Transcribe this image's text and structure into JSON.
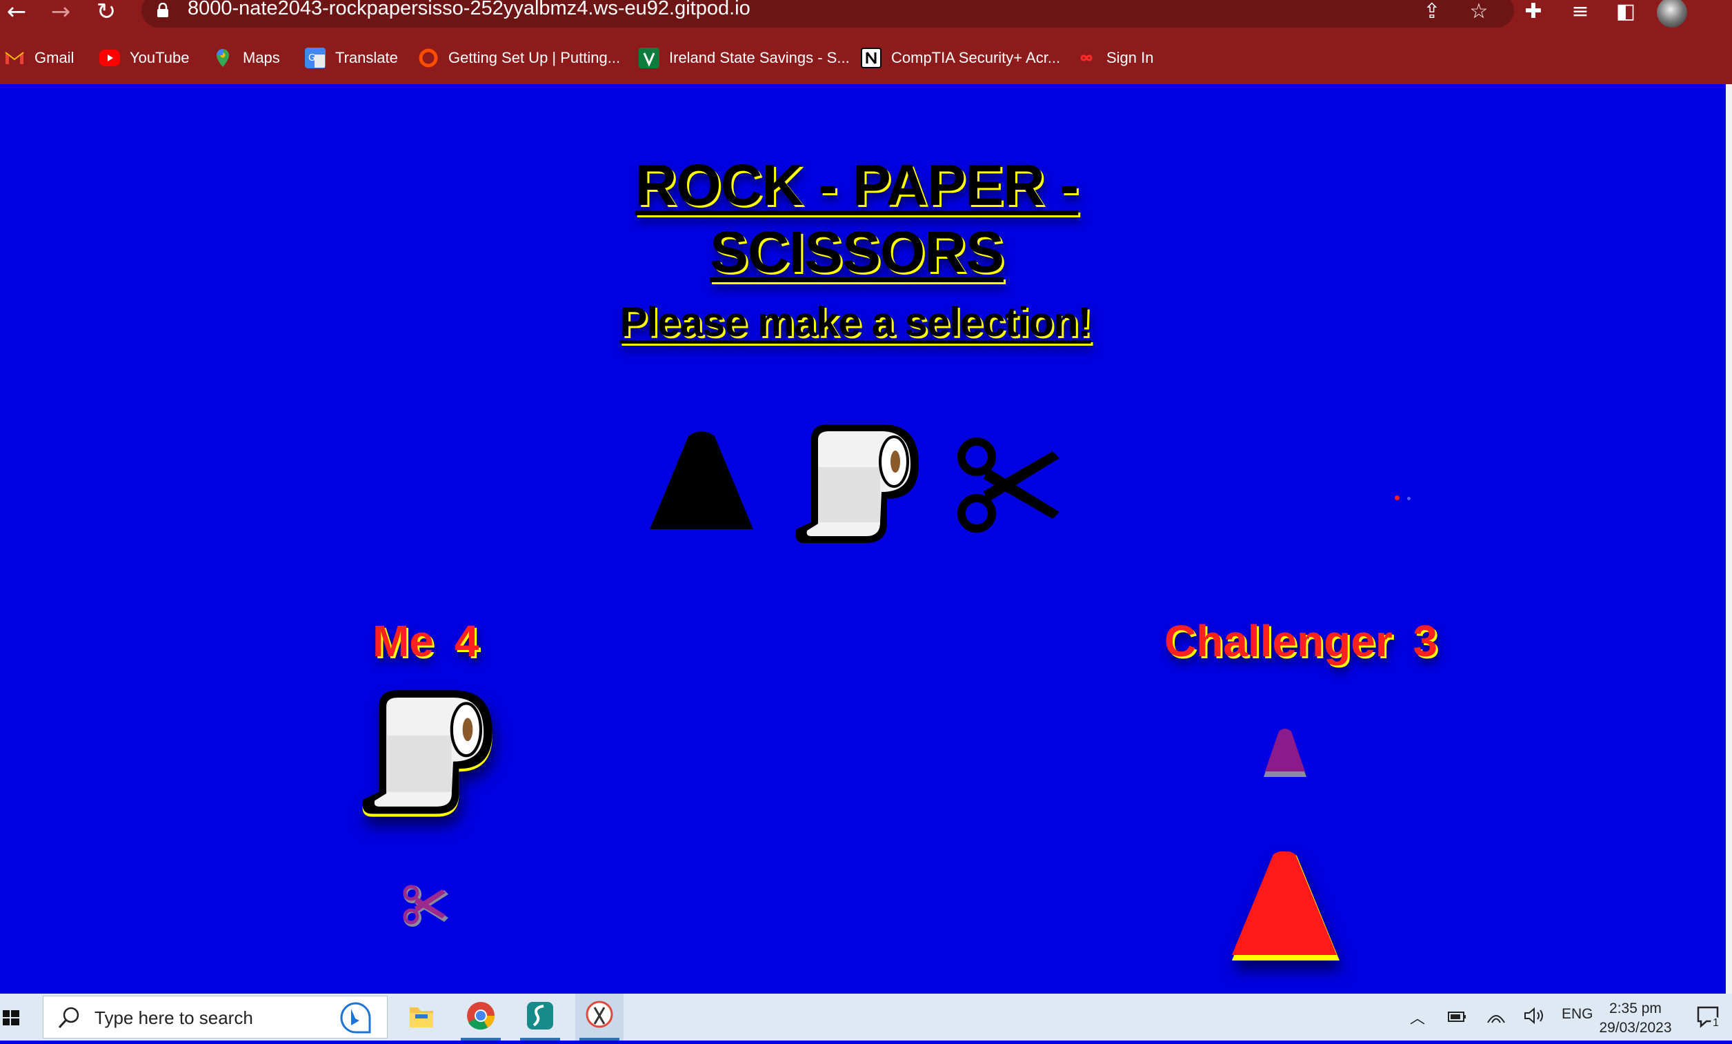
{
  "browser": {
    "url": "8000-nate2043-rockpapersisso-252yyalbmz4.ws-eu92.gitpod.io",
    "bookmarks": [
      {
        "label": "Gmail",
        "icon": "gmail-icon"
      },
      {
        "label": "YouTube",
        "icon": "youtube-icon"
      },
      {
        "label": "Maps",
        "icon": "maps-icon"
      },
      {
        "label": "Translate",
        "icon": "translate-icon"
      },
      {
        "label": "Getting Set Up | Putting...",
        "icon": "ring-icon"
      },
      {
        "label": "Ireland State Savings - S...",
        "icon": "state-savings-icon"
      },
      {
        "label": "CompTIA Security+ Acr...",
        "icon": "notion-icon"
      },
      {
        "label": "Sign In",
        "icon": "infinity-icon"
      }
    ]
  },
  "game": {
    "title": "ROCK - PAPER - SCISSORS",
    "prompt": "Please make a selection!",
    "choices": [
      "rock",
      "paper",
      "scissors"
    ],
    "player": {
      "label": "Me",
      "score": "4",
      "current_choice": "paper",
      "previous_choice": "scissors"
    },
    "challenger": {
      "label": "Challenger",
      "score": "3",
      "current_choice": "rock",
      "previous_choice": "rock"
    }
  },
  "taskbar": {
    "search_placeholder": "Type here to search",
    "language": "ENG",
    "time": "2:35 pm",
    "date": "29/03/2023",
    "notification_count": "1"
  },
  "colors": {
    "chrome": "#8e1b1b",
    "page_background": "#0000e0",
    "text_shadow": "#ffff00",
    "score_text": "#ff2020",
    "challenger_rock": "#ff1a1a"
  }
}
